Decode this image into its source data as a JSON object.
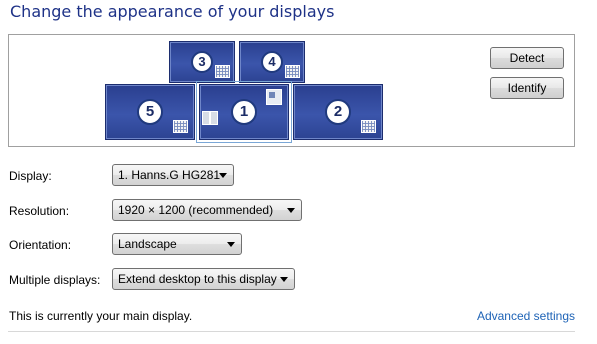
{
  "header": {
    "title": "Change the appearance of your displays"
  },
  "arrangement": {
    "monitors": [
      {
        "id": "3",
        "label": "3"
      },
      {
        "id": "4",
        "label": "4"
      },
      {
        "id": "5",
        "label": "5"
      },
      {
        "id": "1",
        "label": "1",
        "selected": true
      },
      {
        "id": "2",
        "label": "2"
      }
    ],
    "detect_label": "Detect",
    "identify_label": "Identify"
  },
  "settings": {
    "display": {
      "label": "Display:",
      "value": "1. Hanns.G HG281"
    },
    "resolution": {
      "label": "Resolution:",
      "value": "1920 × 1200 (recommended)"
    },
    "orientation": {
      "label": "Orientation:",
      "value": "Landscape"
    },
    "multiple": {
      "label": "Multiple displays:",
      "value": "Extend desktop to this display"
    }
  },
  "footer": {
    "status": "This is currently your main display.",
    "advanced_link": "Advanced settings"
  },
  "colors": {
    "title": "#1e3287",
    "link": "#1e63b6",
    "monitor": "#2f4796"
  }
}
